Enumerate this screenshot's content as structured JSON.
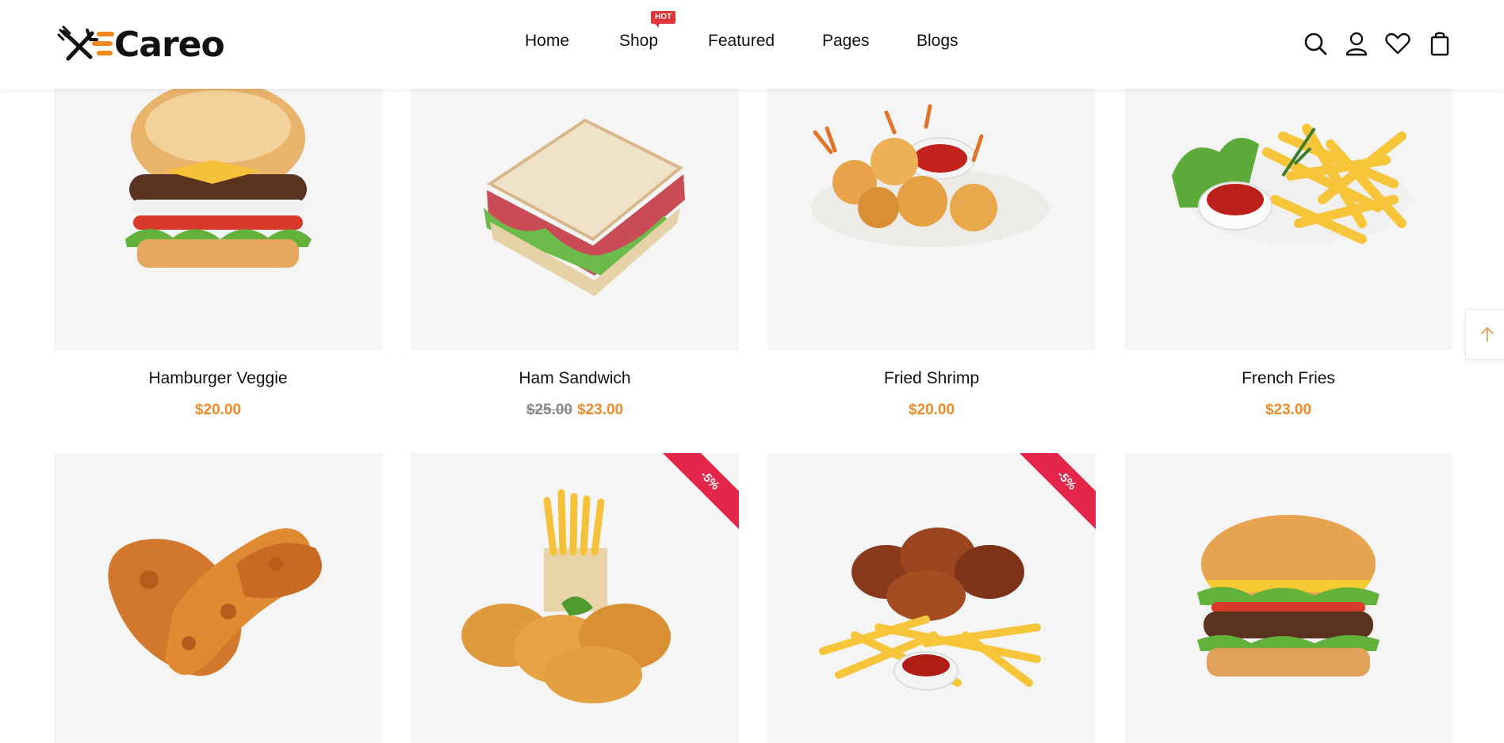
{
  "header": {
    "brand": "Careo",
    "nav": [
      {
        "label": "Home"
      },
      {
        "label": "Shop"
      },
      {
        "label": "Featured"
      },
      {
        "label": "Pages"
      },
      {
        "label": "Blogs"
      }
    ],
    "hot_badge": "HOT",
    "icons": [
      "search-icon",
      "user-icon",
      "heart-icon",
      "cart-icon"
    ]
  },
  "products": [
    {
      "name": "Hamburger Veggie",
      "price": "$20.00",
      "old_price": "",
      "badge": ""
    },
    {
      "name": "Ham Sandwich",
      "price": "$23.00",
      "old_price": "$25.00",
      "badge": ""
    },
    {
      "name": "Fried Shrimp",
      "price": "$20.00",
      "old_price": "",
      "badge": ""
    },
    {
      "name": "French Fries",
      "price": "$23.00",
      "old_price": "",
      "badge": ""
    },
    {
      "name": "",
      "price": "",
      "old_price": "",
      "badge": ""
    },
    {
      "name": "",
      "price": "",
      "old_price": "",
      "badge": "-5%"
    },
    {
      "name": "",
      "price": "",
      "old_price": "",
      "badge": "-5%"
    },
    {
      "name": "",
      "price": "",
      "old_price": "",
      "badge": ""
    }
  ],
  "colors": {
    "accent": "#ef8a2b",
    "sale": "#e3264a",
    "card_bg": "#f5f5f5"
  }
}
